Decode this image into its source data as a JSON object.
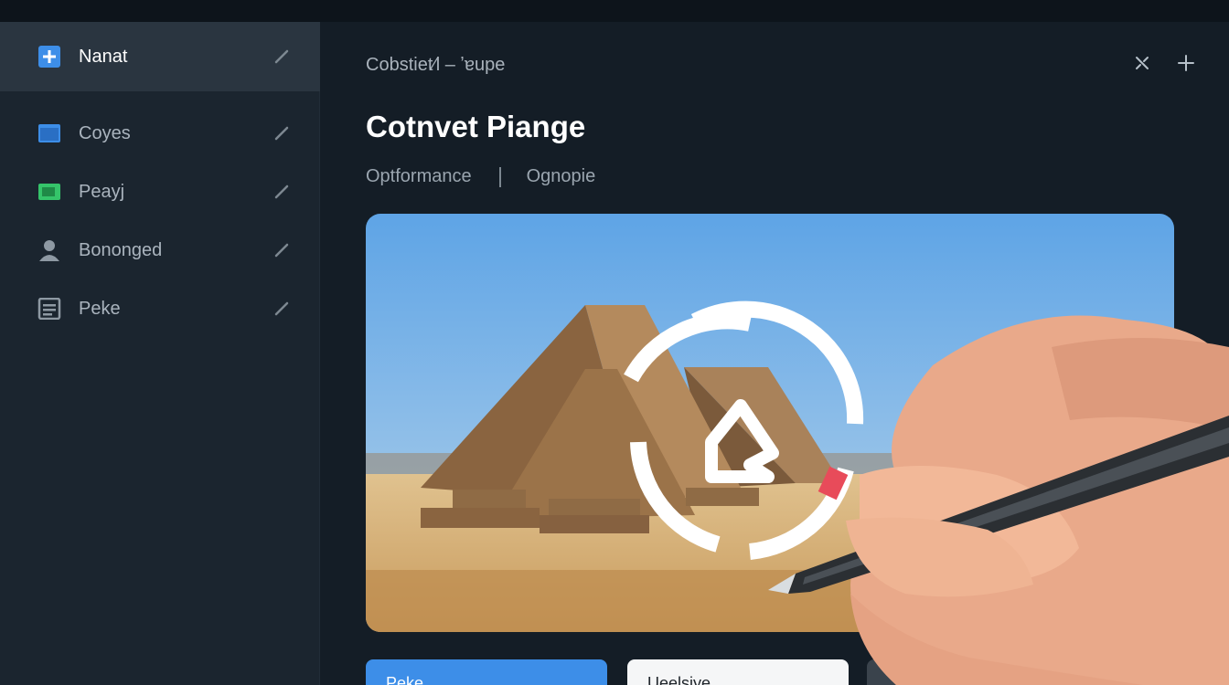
{
  "sidebar": {
    "items": [
      {
        "label": "Nanat",
        "icon": "plus-square-icon",
        "active": true
      },
      {
        "label": "Coyes",
        "icon": "window-icon"
      },
      {
        "label": "Peayj",
        "icon": "folder-icon"
      },
      {
        "label": "Bononged",
        "icon": "user-icon"
      },
      {
        "label": "Peke",
        "icon": "document-icon"
      }
    ]
  },
  "header": {
    "breadcrumb": "Cobstiet⁄l – ʼɐupe",
    "title": "Cotnvet Piange",
    "tabs": [
      "Optformance",
      "Ognopie"
    ]
  },
  "buttons": {
    "primary": "Peke",
    "secondary": "Ueelsiye"
  },
  "colors": {
    "accent": "#3d8ee8",
    "sidebar_bg": "#1b252f",
    "main_bg": "#141d26",
    "green_icon": "#35c46a"
  }
}
